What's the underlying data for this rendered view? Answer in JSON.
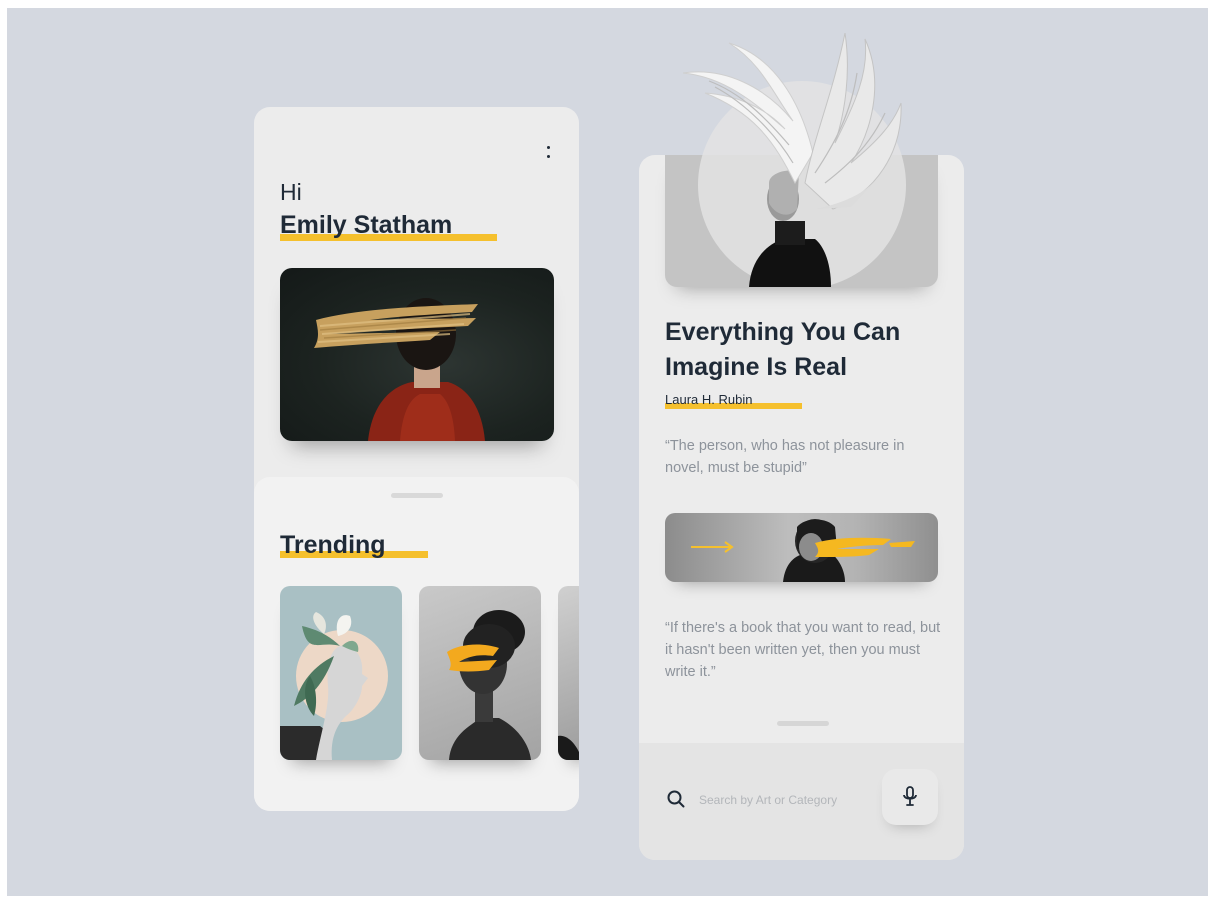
{
  "home": {
    "menu_icon": "more-vertical-icon",
    "greeting": "Hi",
    "user_name": "Emily Statham",
    "trending": {
      "title": "Trending"
    }
  },
  "detail": {
    "title": "Everything You Can Imagine Is Real",
    "author": "Laura H. Rubin",
    "quote_1": "“The person, who has not pleasure in novel, must be stupid”",
    "quote_2": "“If there's a book that you want to read, but it hasn't been written yet, then you must write it.”",
    "search": {
      "placeholder": "Search by Art or Category",
      "search_icon": "search-icon",
      "mic_icon": "microphone-icon"
    }
  },
  "colors": {
    "background": "#d4d8e0",
    "card": "#ececec",
    "accent": "#f5c02d",
    "heading": "#1f2a37",
    "quote_text": "#8d939b"
  }
}
